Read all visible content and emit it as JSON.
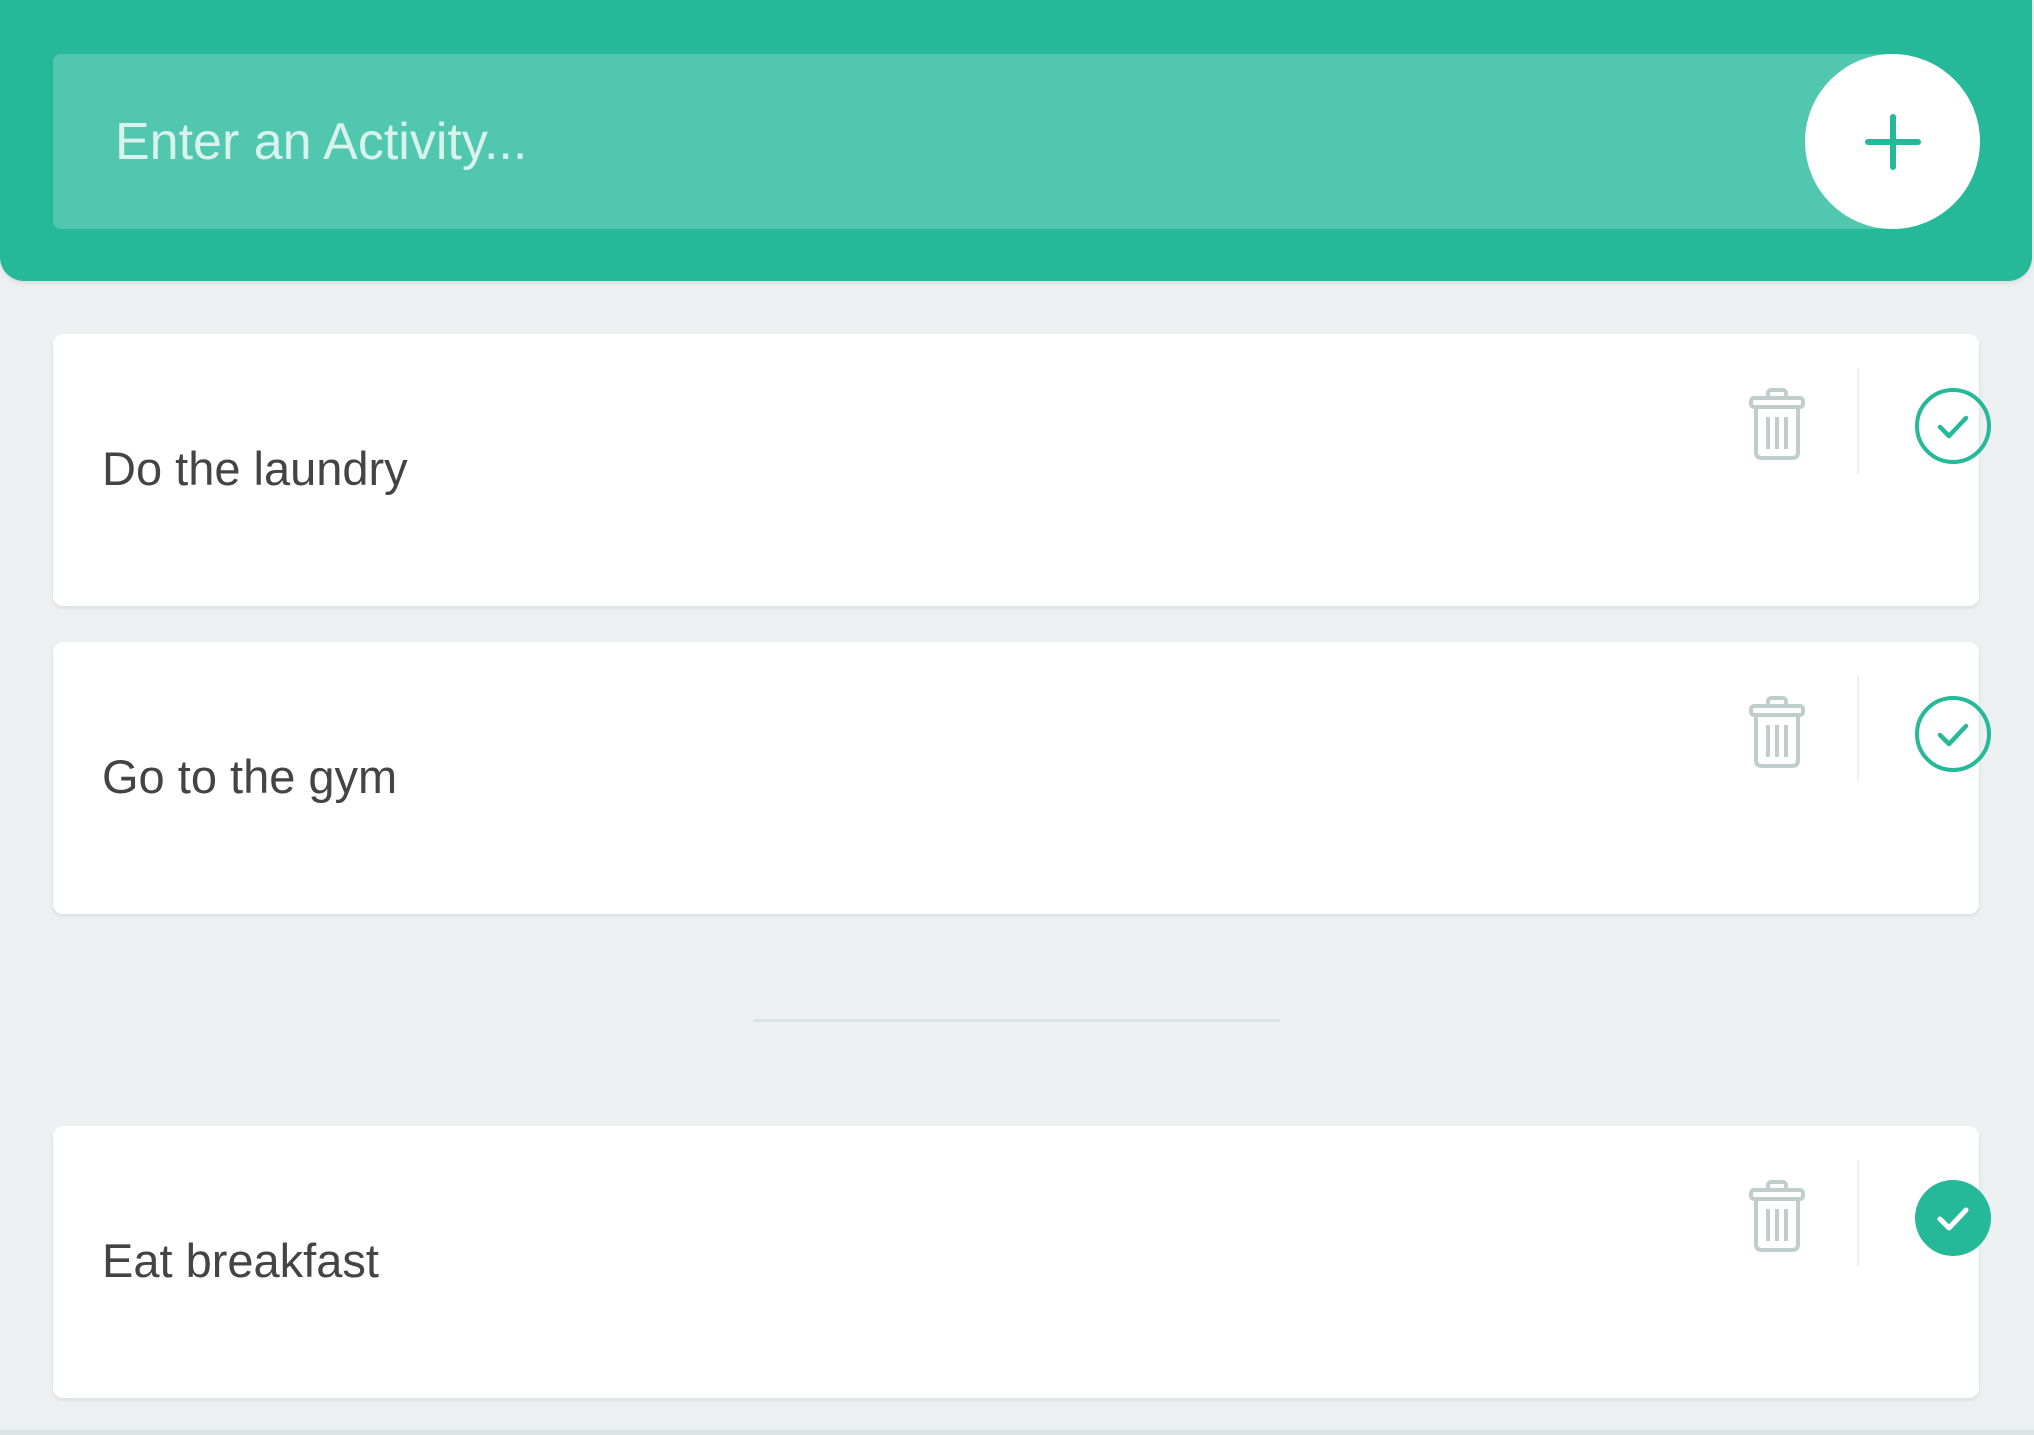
{
  "colors": {
    "accent": "#25b99a",
    "background": "#edf0f1",
    "card": "#ffffff",
    "text": "#444444",
    "icon_muted": "#c0cecb"
  },
  "header": {
    "input_placeholder": "Enter an Activity...",
    "input_value": "",
    "add_button_icon": "plus-icon"
  },
  "todo": {
    "items": [
      {
        "label": "Do the laundry",
        "completed": false,
        "remove_icon": "trash-icon",
        "complete_icon": "check-circle-outline-icon"
      },
      {
        "label": "Go to the gym",
        "completed": false,
        "remove_icon": "trash-icon",
        "complete_icon": "check-circle-outline-icon"
      }
    ]
  },
  "completed": {
    "items": [
      {
        "label": "Eat breakfast",
        "completed": true,
        "remove_icon": "trash-icon",
        "complete_icon": "check-circle-filled-icon"
      }
    ]
  }
}
